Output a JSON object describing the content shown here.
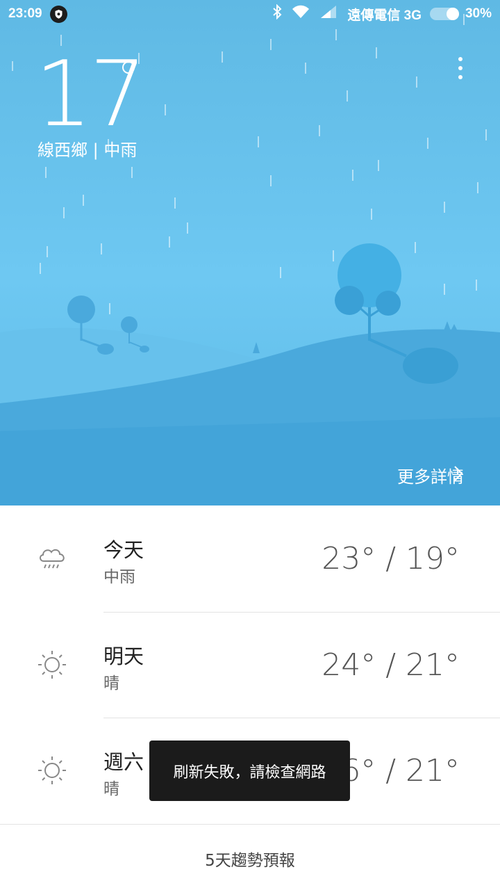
{
  "status_bar": {
    "time": "23:09",
    "carrier": "遠傳電信 3G",
    "battery_percent": "30%",
    "icons": [
      "shield-icon",
      "bluetooth-icon",
      "wifi-icon",
      "signal-icon",
      "battery-icon"
    ]
  },
  "current": {
    "temperature": "17",
    "location": "線西鄉 | 中雨"
  },
  "more_details": "更多詳情",
  "forecast_rows": [
    {
      "day": "今天",
      "condition": "中雨",
      "temps": "23° / 19°",
      "icon": "rain-cloud-icon"
    },
    {
      "day": "明天",
      "condition": "晴",
      "temps": "24° / 21°",
      "icon": "sun-icon"
    },
    {
      "day": "週六",
      "condition": "晴",
      "temps": "26° / 21°",
      "icon": "sun-icon"
    }
  ],
  "five_day_link": "5天趨勢預報",
  "toast": "刷新失敗，請檢查網路",
  "colors": {
    "sky": "#6ec8f2",
    "hill": "#4aa9dc",
    "toast_bg": "#1b1b1b"
  }
}
